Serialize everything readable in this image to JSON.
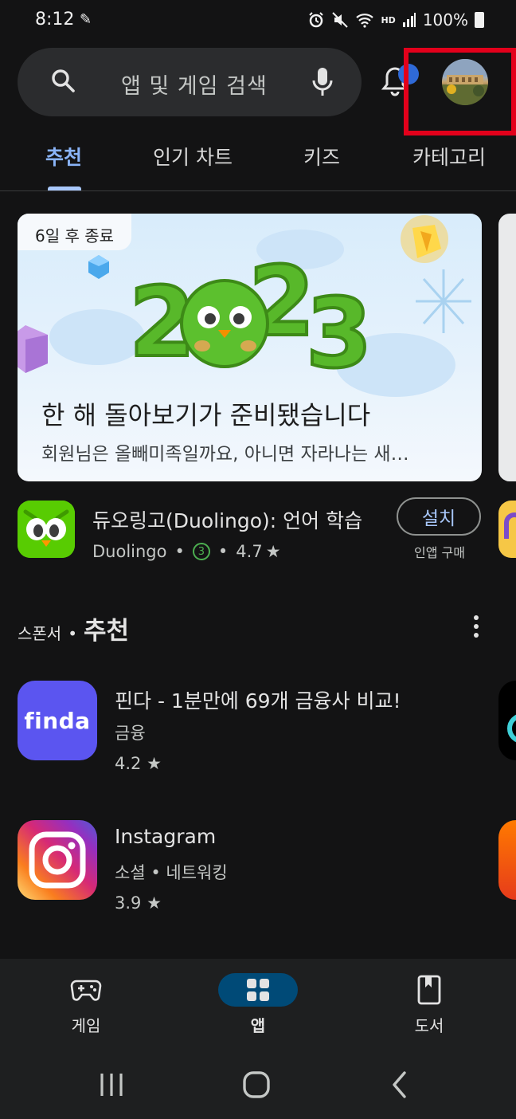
{
  "status_bar": {
    "time": "8:12",
    "hd_label": "HD",
    "battery": "100%"
  },
  "search": {
    "placeholder": "앱 및 게임 검색"
  },
  "tabs": [
    {
      "label": "추천"
    },
    {
      "label": "인기 차트"
    },
    {
      "label": "키즈"
    },
    {
      "label": "카테고리"
    }
  ],
  "promo": {
    "tag": "6일 후 종료",
    "art_text": "2023",
    "title": "한 해 돌아보기가 준비됐습니다",
    "subtitle": "회원님은 올빼미족일까요, 아니면 자라나는 새…"
  },
  "featured_app": {
    "name": "듀오링고(Duolingo): 언어 학습",
    "developer": "Duolingo",
    "age_rating": "3",
    "rating": "4.7",
    "install_label": "설치",
    "iap_label": "인앱 구매"
  },
  "sponsored": {
    "prefix": "스폰서",
    "title": "추천",
    "apps": [
      {
        "name": "핀다 - 1분만에 69개 금융사 비교!",
        "category": "금융",
        "rating": "4.2",
        "icon_text": "finda",
        "icon_color": "#5b55f0"
      },
      {
        "name": "Instagram",
        "category": "소셜 • 네트워킹",
        "rating": "3.9",
        "icon_color": "#d62976"
      }
    ]
  },
  "bottom_nav": [
    {
      "label": "게임",
      "icon": "gamepad-icon"
    },
    {
      "label": "앱",
      "icon": "apps-grid-icon",
      "active": true
    },
    {
      "label": "도서",
      "icon": "book-icon"
    }
  ],
  "colors": {
    "accent": "#8ab4f8",
    "highlight_box": "#e3001b",
    "badge": "#2f6ad8"
  }
}
